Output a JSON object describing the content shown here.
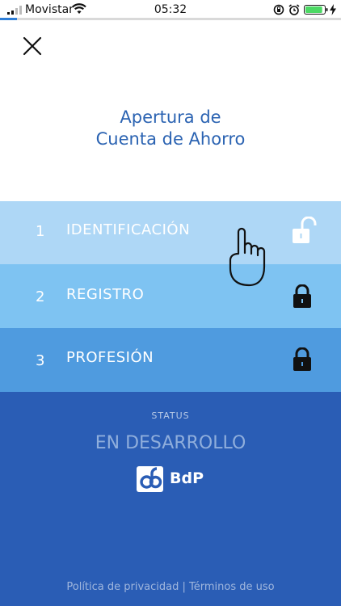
{
  "status_bar": {
    "carrier": "Movistar",
    "time": "05:32",
    "battery_level": 0.9
  },
  "progress": {
    "fraction": 0.05
  },
  "header": {
    "title_line1": "Apertura de",
    "title_line2": "Cuenta de Ahorro"
  },
  "steps": [
    {
      "number": "1",
      "label": "IDENTIFICACIÓN",
      "lock_state": "unlocked",
      "color": "#aed7f6"
    },
    {
      "number": "2",
      "label": "REGISTRO",
      "lock_state": "locked",
      "color": "#7ec3f2"
    },
    {
      "number": "3",
      "label": "PROFESIÓN",
      "lock_state": "locked",
      "color": "#4f9bdf"
    }
  ],
  "footer": {
    "status_label": "STATUS",
    "status_value": "EN DESARROLLO",
    "brand_text": "BdP",
    "privacy_link": "Política de privacidad",
    "separator": "|",
    "terms_link": "Términos de uso"
  },
  "colors": {
    "title": "#2b63b2",
    "footer_bg": "#2a5db5",
    "progress": "#2f7fd8"
  },
  "icons": {
    "close": "close-icon",
    "pointer": "pointing-hand-icon",
    "lock_open": "lock-open-icon",
    "lock_closed": "lock-icon",
    "brand": "bdp-logo"
  }
}
